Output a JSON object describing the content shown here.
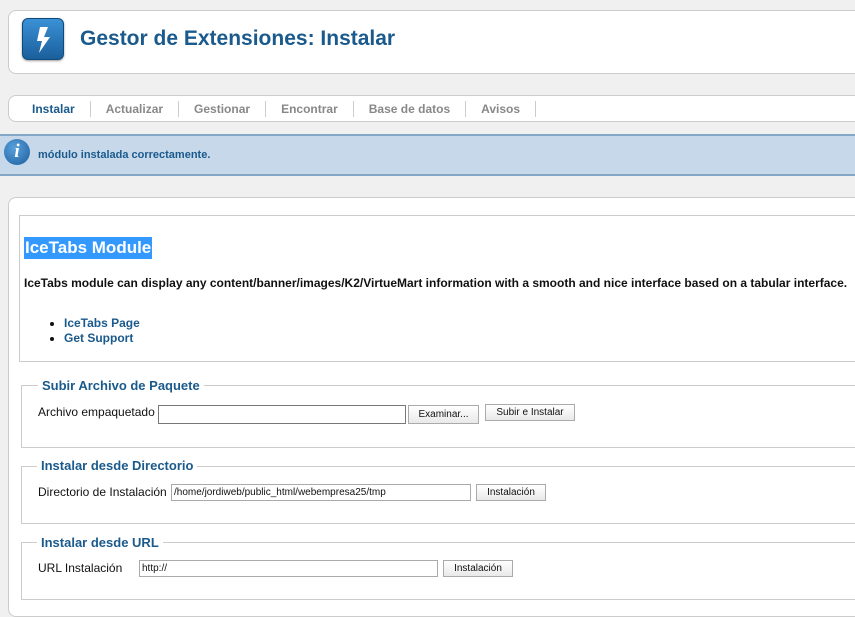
{
  "header": {
    "title": "Gestor de Extensiones: Instalar",
    "icon": "extensions-lightning-icon"
  },
  "submenu": {
    "items": [
      {
        "label": "Instalar",
        "active": true
      },
      {
        "label": "Actualizar",
        "active": false
      },
      {
        "label": "Gestionar",
        "active": false
      },
      {
        "label": "Encontrar",
        "active": false
      },
      {
        "label": "Base de datos",
        "active": false
      },
      {
        "label": "Avisos",
        "active": false
      }
    ]
  },
  "message": {
    "icon": "info-icon",
    "text": "módulo instalada correctamente."
  },
  "module": {
    "title": "IceTabs Module",
    "description": "IceTabs module can display any content/banner/images/K2/VirtueMart information with a smooth and nice interface based on a tabular interface.",
    "links": [
      "IceTabs Page",
      "Get Support"
    ]
  },
  "upload": {
    "legend": "Subir Archivo de Paquete",
    "label": "Archivo empaquetado",
    "file_value": "",
    "browse_label": "Examinar...",
    "submit_label": "Subir e Instalar"
  },
  "directory": {
    "legend": "Instalar desde Directorio",
    "label": "Directorio de Instalación",
    "value": "/home/jordiweb/public_html/webempresa25/tmp",
    "submit_label": "Instalación"
  },
  "url": {
    "legend": "Instalar desde URL",
    "label": "URL Instalación",
    "value": "http://",
    "submit_label": "Instalación"
  },
  "colors": {
    "accent": "#1a5a8c",
    "message_bg": "#c6d8ea",
    "highlight": "#3399ff"
  }
}
